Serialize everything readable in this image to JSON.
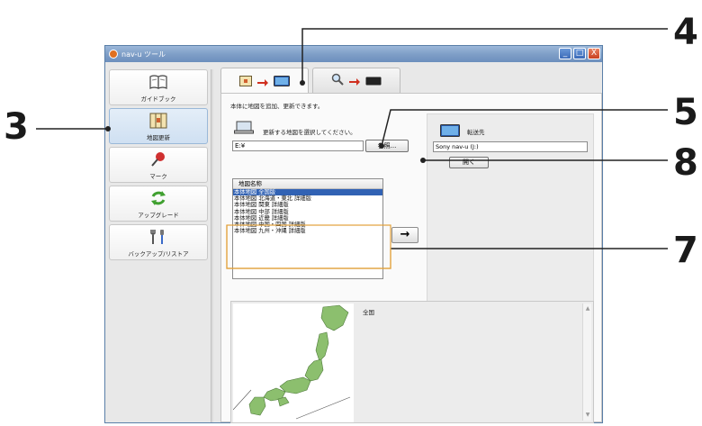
{
  "window": {
    "title": "nav-u ツール",
    "controls": [
      "_",
      "□",
      "X"
    ]
  },
  "sidebar": {
    "items": [
      {
        "label": "ガイドブック",
        "icon": "book-icon"
      },
      {
        "label": "地図更新",
        "icon": "map-update-icon",
        "selected": true
      },
      {
        "label": "マーク",
        "icon": "pushpin-icon"
      },
      {
        "label": "アップグレード",
        "icon": "refresh-icon"
      },
      {
        "label": "バックアップ/リストア",
        "icon": "tools-icon"
      }
    ]
  },
  "tabs": [
    {
      "name": "map-to-device",
      "icons": [
        "map-icon",
        "arrow-icon",
        "device-icon"
      ],
      "active": true
    },
    {
      "name": "search-to-device",
      "icons": [
        "magnifier-icon",
        "arrow-icon",
        "device-icon"
      ],
      "active": false
    }
  ],
  "panel": {
    "info_text": "本体に地図を追加、更新できます。",
    "source_label": "更新する地図を選択してください。",
    "source_value": "E:¥",
    "browse_label": "参照...",
    "maplist": {
      "header": "地図名称",
      "rows": [
        "本体地図 全国版",
        "本体地図 北海道・東北 詳細版",
        "本体地図 関東 詳細版",
        "本体地図 中部 詳細版",
        "本体地図 近畿 詳細版",
        "本体地図 中国・四国 詳細版",
        "本体地図 九州・沖縄 詳細版"
      ],
      "selected_index": 0
    },
    "transfer_arrow": "→",
    "dest_label": "転送先",
    "dest_value": "Sony nav-u (J:)",
    "open_label": "開く",
    "preview_label": "全国"
  },
  "callouts": [
    "3",
    "4",
    "5",
    "7",
    "8"
  ],
  "colors": {
    "selection": "#3162b4",
    "map_green": "#8cbf6e",
    "titlebar": "#7d9dc6"
  }
}
